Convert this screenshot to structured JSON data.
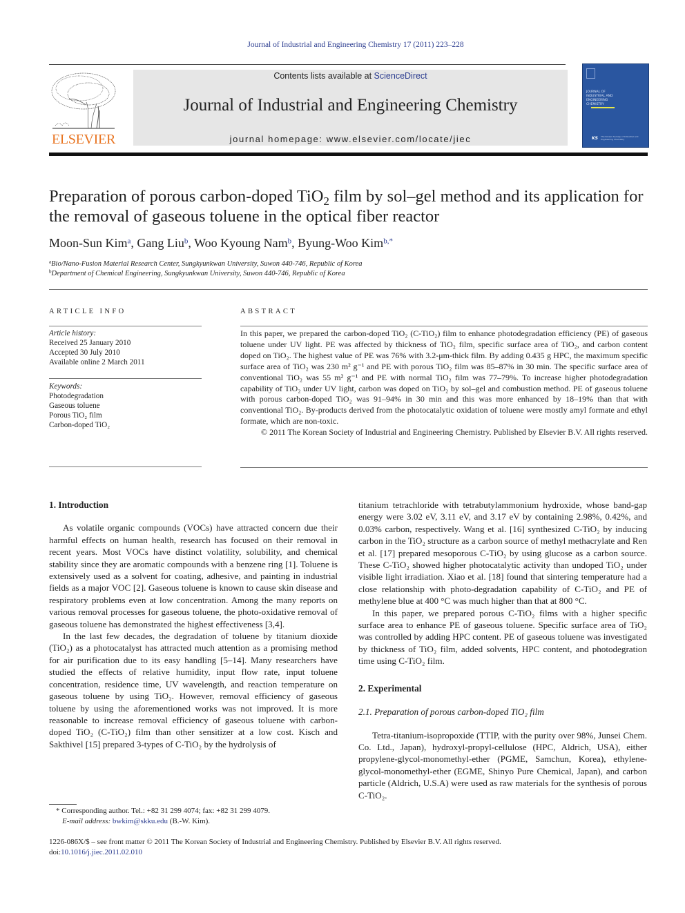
{
  "header": {
    "running_head": "Journal of Industrial and Engineering Chemistry 17 (2011) 223–228",
    "publisher_logo_text": "ELSEVIER",
    "contents_prefix": "Contents lists available at ",
    "contents_link": "ScienceDirect",
    "journal_title": "Journal of Industrial and Engineering Chemistry",
    "homepage": "journal homepage: www.elsevier.com/locate/jiec",
    "cover": {
      "title_lines": [
        "Journal of",
        "Industrial and",
        "Engineering",
        "Chemistry"
      ],
      "society_logo": "KS",
      "society_text": "The Korean Society of Industrial and Engineering Chemistry",
      "cover_color": "#2a56a0"
    }
  },
  "article": {
    "title_part1": "Preparation of porous carbon-doped TiO",
    "title_sub": "2",
    "title_part2": " film by sol–gel method and its application for the removal of gaseous toluene in the optical fiber reactor",
    "authors": [
      {
        "name": "Moon-Sun Kim",
        "aff": "a"
      },
      {
        "name": "Gang Liu",
        "aff": "b"
      },
      {
        "name": "Woo Kyoung Nam",
        "aff": "b"
      },
      {
        "name": "Byung-Woo Kim",
        "aff": "b,*"
      }
    ],
    "affiliations": [
      {
        "mark": "a",
        "text": "Bio/Nano-Fusion Material Research Center, Sungkyunkwan University, Suwon 440-746, Republic of Korea"
      },
      {
        "mark": "b",
        "text": "Department of Chemical Engineering, Sungkyunkwan University, Suwon 440-746, Republic of Korea"
      }
    ]
  },
  "article_info": {
    "heading": "ARTICLE INFO",
    "history_label": "Article history:",
    "history": [
      "Received 25 January 2010",
      "Accepted 30 July 2010",
      "Available online 2 March 2011"
    ],
    "keywords_label": "Keywords:",
    "keywords": [
      "Photodegradation",
      "Gaseous toluene",
      "Porous TiO₂ film",
      "Carbon-doped TiO₂"
    ]
  },
  "abstract": {
    "heading": "ABSTRACT",
    "text": "In this paper, we prepared the carbon-doped TiO₂ (C-TiO₂) film to enhance photodegradation efficiency (PE) of gaseous toluene under UV light. PE was affected by thickness of TiO₂ film, specific surface area of TiO₂, and carbon content doped on TiO₂. The highest value of PE was 76% with 3.2-μm-thick film. By adding 0.435 g HPC, the maximum specific surface area of TiO₂ was 230 m² g⁻¹ and PE with porous TiO₂ film was 85–87% in 30 min. The specific surface area of conventional TiO₂ was 55 m² g⁻¹ and PE with normal TiO₂ film was 77–79%. To increase higher photodegradation capability of TiO₂ under UV light, carbon was doped on TiO₂ by sol–gel and combustion method. PE of gaseous toluene with porous carbon-doped TiO₂ was 91–94% in 30 min and this was more enhanced by 18–19% than that with conventional TiO₂. By-products derived from the photocatalytic oxidation of toluene were mostly amyl formate and ethyl formate, which are non-toxic.",
    "copyright": "© 2011 The Korean Society of Industrial and Engineering Chemistry. Published by Elsevier B.V. All rights reserved."
  },
  "body": {
    "intro_heading": "1.  Introduction",
    "intro_p1": "As volatile organic compounds (VOCs) have attracted concern due their harmful effects on human health, research has focused on their removal in recent years. Most VOCs have distinct volatility, solubility, and chemical stability since they are aromatic compounds with a benzene ring [1]. Toluene is extensively used as a solvent for coating, adhesive, and painting in industrial fields as a major VOC [2]. Gaseous toluene is known to cause skin disease and respiratory problems even at low concentration. Among the many reports on various removal processes for gaseous toluene, the photo-oxidative removal of gaseous toluene has demonstrated the highest effectiveness [3,4].",
    "intro_p2": "In the last few decades, the degradation of toluene by titanium dioxide (TiO₂) as a photocatalyst has attracted much attention as a promising method for air purification due to its easy handling [5–14]. Many researchers have studied the effects of relative humidity, input flow rate, input toluene concentration, residence time, UV wavelength, and reaction temperature on gaseous toluene by using TiO₂. However, removal efficiency of gaseous toluene by using the aforementioned works was not improved. It is more reasonable to increase removal efficiency of gaseous toluene with carbon-doped TiO₂ (C-TiO₂) film than other sensitizer at a low cost. Kisch and Sakthivel [15] prepared 3-types of C-TiO₂ by the hydrolysis of",
    "intro_p2_cont": "titanium tetrachloride with tetrabutylammonium hydroxide, whose band-gap energy were 3.02 eV, 3.11 eV, and 3.17 eV by containing 2.98%, 0.42%, and 0.03% carbon, respectively. Wang et al. [16] synthesized C-TiO₂ by inducing carbon in the TiO₂ structure as a carbon source of methyl methacrylate and Ren et al. [17] prepared mesoporous C-TiO₂ by using glucose as a carbon source. These C-TiO₂ showed higher photocatalytic activity than undoped TiO₂ under visible light irradiation. Xiao et al. [18] found that sintering temperature had a close relationship with photo-degradation capability of C-TiO₂ and PE of methylene blue at 400 °C was much higher than that at 800 °C.",
    "intro_p3": "In this paper, we prepared porous C-TiO₂ films with a higher specific surface area to enhance PE of gaseous toluene. Specific surface area of TiO₂ was controlled by adding HPC content. PE of gaseous toluene was investigated by thickness of TiO₂ film, added solvents, HPC content, and photodegration time using C-TiO₂ film.",
    "exp_heading": "2.  Experimental",
    "exp_sub_heading": "2.1.  Preparation of porous carbon-doped TiO₂ film",
    "exp_p1": "Tetra-titanium-isopropoxide (TTIP, with the purity over 98%, Junsei Chem. Co. Ltd., Japan), hydroxyl-propyl-cellulose (HPC, Aldrich, USA), either propylene-glycol-monomethyl-ether (PGME, Samchun, Korea), ethylene-glycol-monomethyl-ether (EGME, Shinyo Pure Chemical, Japan), and carbon particle (Aldrich, U.S.A) were used as raw materials for the synthesis of porous C-TiO₂."
  },
  "footnote": {
    "mark": "*",
    "corresponding": "Corresponding author. Tel.: +82 31 299 4074; fax: +82 31 299 4079.",
    "email_label": "E-mail address: ",
    "email": "bwkim@skku.edu",
    "email_suffix": " (B.-W. Kim)."
  },
  "footer": {
    "issn_line": "1226-086X/$ – see front matter © 2011 The Korean Society of Industrial and Engineering Chemistry. Published by Elsevier B.V. All rights reserved.",
    "doi_label": "doi:",
    "doi": "10.1016/j.jiec.2011.02.010"
  },
  "colors": {
    "link": "#2a3b8f",
    "elsevier_orange": "#e8731f",
    "banner_gray": "#e6e6e6"
  }
}
